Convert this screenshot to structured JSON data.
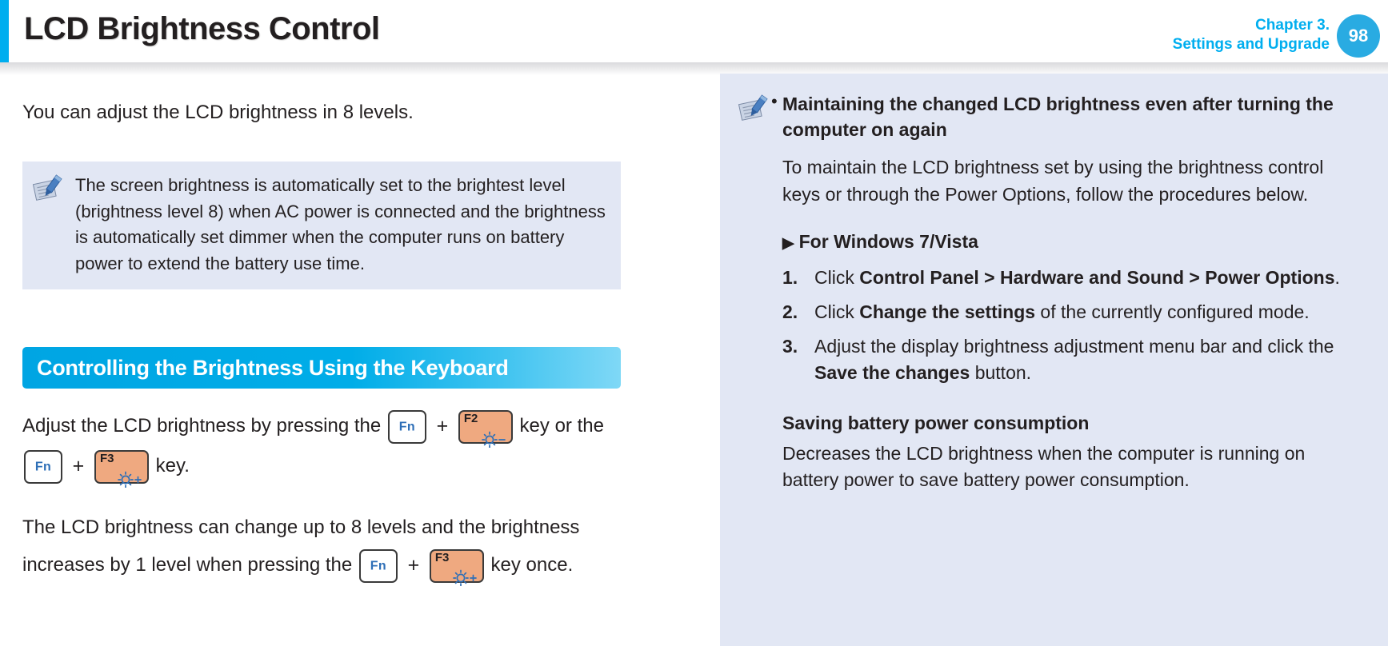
{
  "header": {
    "title": "LCD Brightness Control",
    "chapter_line1": "Chapter 3.",
    "chapter_line2": "Settings and Upgrade",
    "page_number": "98",
    "accent_color": "#00AEEF",
    "badge_color": "#29ABE2"
  },
  "left": {
    "lead": "You can adjust the LCD brightness in 8 levels.",
    "note": {
      "icon": "note-pen-icon",
      "text": "The screen brightness is automatically set to the brightest level (brightness level 8) when AC power is connected and the brightness is automatically set dimmer when the computer runs on battery power to extend the battery use time."
    },
    "section_title": "Controlling the Brightness Using the Keyboard",
    "para1_part1": "Adjust the LCD brightness by pressing the",
    "para1_part2": "key or the",
    "para1_part3": "key.",
    "para2_part1": "The LCD brightness can change up to 8 levels and the brightness increases by 1 level when pressing the",
    "para2_part2": "key once.",
    "keys": {
      "fn": "Fn",
      "f2": "F2",
      "f3": "F3",
      "f2_icon": "brightness-down-icon",
      "f3_icon": "brightness-up-icon",
      "plus": "+",
      "fn_text_color": "#2E6FB7",
      "fkey_bg_color": "#EFA980"
    }
  },
  "right": {
    "icon": "note-pen-icon",
    "bullet": "•",
    "heading": "Maintaining the changed LCD brightness even after turning the computer on again",
    "para": "To maintain the LCD brightness set by using the brightness control keys or through the Power Options, follow the procedures below.",
    "subhead_marker": "▶",
    "subhead": "For Windows 7/Vista",
    "steps": [
      {
        "num": "1.",
        "segments": [
          {
            "text": "Click ",
            "bold": false
          },
          {
            "text": "Control Panel > Hardware and Sound > Power Options",
            "bold": true
          },
          {
            "text": ".",
            "bold": false
          }
        ]
      },
      {
        "num": "2.",
        "segments": [
          {
            "text": "Click ",
            "bold": false
          },
          {
            "text": "Change the settings",
            "bold": true
          },
          {
            "text": " of the currently configured mode.",
            "bold": false
          }
        ]
      },
      {
        "num": "3.",
        "segments": [
          {
            "text": "Adjust the display brightness adjustment menu bar and click the ",
            "bold": false
          },
          {
            "text": "Save the changes",
            "bold": true
          },
          {
            "text": " button.",
            "bold": false
          }
        ]
      }
    ],
    "block_head": "Saving battery power consumption",
    "block_para": "Decreases the LCD brightness when the computer is running on battery power to save battery power consumption.",
    "panel_color": "#E2E7F4"
  }
}
